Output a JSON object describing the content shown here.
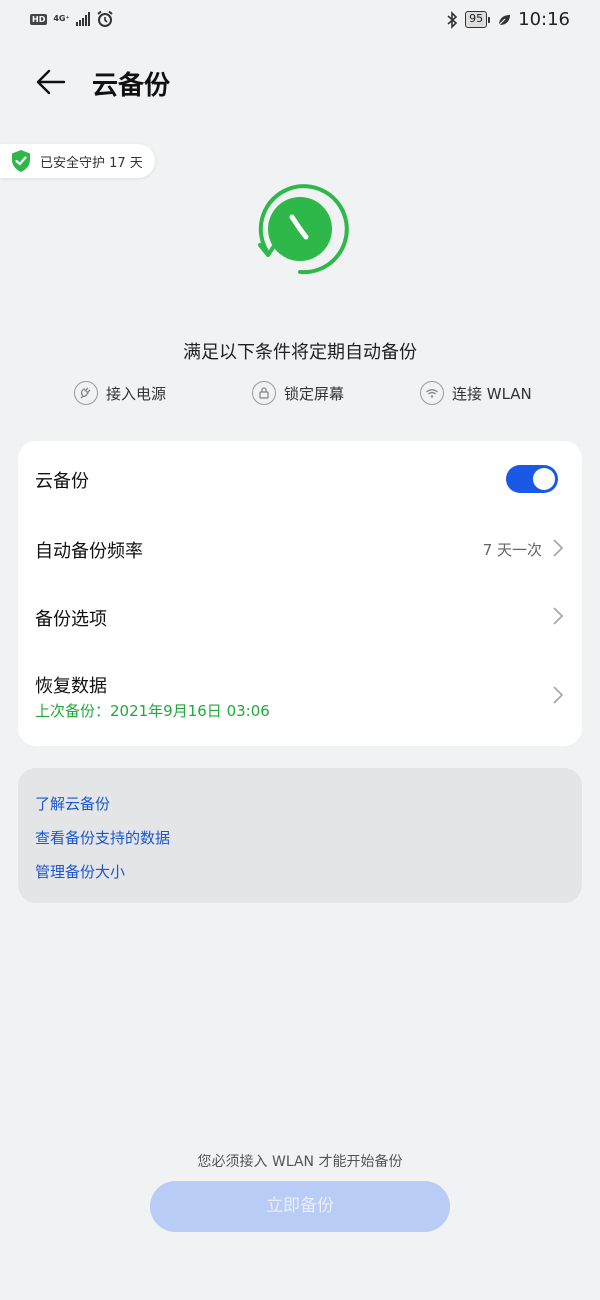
{
  "statusbar": {
    "hd": "HD",
    "network": "4G⁺",
    "battery": "95",
    "time": "10:16"
  },
  "header": {
    "title": "云备份"
  },
  "protection": {
    "label": "已安全守护 17 天"
  },
  "conditions": {
    "title": "满足以下条件将定期自动备份",
    "items": [
      {
        "label": "接入电源",
        "icon": "plug-icon"
      },
      {
        "label": "锁定屏幕",
        "icon": "lock-icon"
      },
      {
        "label": "连接 WLAN",
        "icon": "wifi-icon"
      }
    ]
  },
  "settings": {
    "cloud_backup_label": "云备份",
    "cloud_backup_enabled": true,
    "frequency_label": "自动备份频率",
    "frequency_value": "7 天一次",
    "options_label": "备份选项",
    "restore_label": "恢复数据",
    "last_backup": "上次备份：2021年9月16日 03:06"
  },
  "links": [
    "了解云备份",
    "查看备份支持的数据",
    "管理备份大小"
  ],
  "footer": {
    "notice": "您必须接入 WLAN 才能开始备份",
    "backup_button": "立即备份"
  },
  "colors": {
    "accent_green": "#2fb84a",
    "toggle_blue": "#1a59e6",
    "link_blue": "#1a56cf",
    "button_disabled": "#b8ccf5"
  }
}
